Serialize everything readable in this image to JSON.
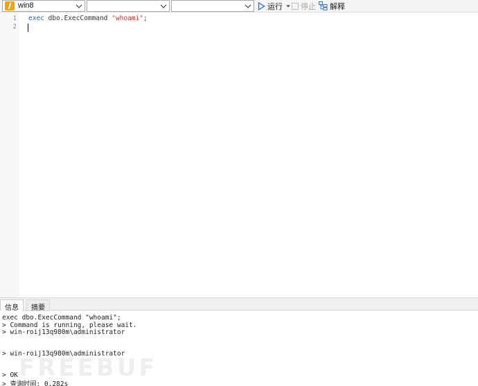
{
  "toolbar": {
    "connection": {
      "value": "win8",
      "icon": "database-icon"
    },
    "database": {
      "value": ""
    },
    "schema": {
      "value": ""
    },
    "run_label": "运行",
    "stop_label": "停止",
    "explain_label": "解释"
  },
  "editor": {
    "line_numbers": [
      "1",
      "2"
    ],
    "line1": {
      "keyword": "exec",
      "mid": " dbo.ExecCommand ",
      "string": "\"whoami\"",
      "tail": ";"
    }
  },
  "tabs": {
    "info": "信息",
    "summary": "摘要"
  },
  "output": [
    "exec dbo.ExecCommand \"whoami\";",
    "> Command is running, please wait.",
    "> win-roij13q980m\\administrator",
    "> win-roij13q980m\\administrator",
    "> OK",
    "> 查询时间: 0.282s"
  ],
  "watermark": "FREEBUF",
  "colors": {
    "keyword": "#2b62c7",
    "string": "#d0342c",
    "connection_icon": "#f0a11c",
    "run_icon": "#2a6fd6"
  }
}
